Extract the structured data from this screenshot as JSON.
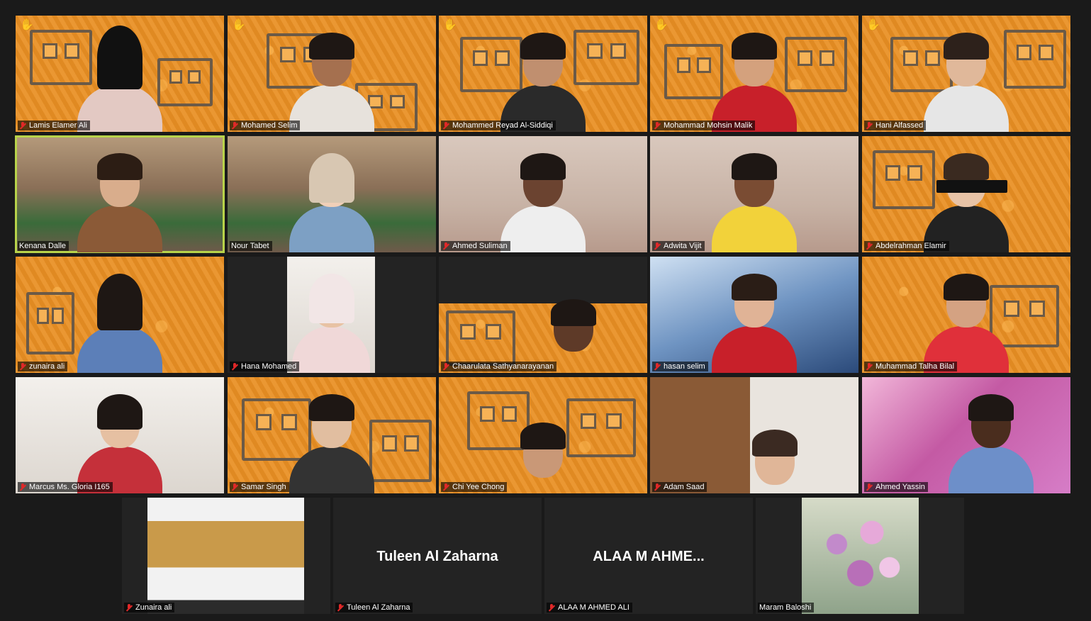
{
  "participants": [
    {
      "name": "Lamis Elamer Ali",
      "muted": true,
      "hand": true
    },
    {
      "name": "Mohamed Selim",
      "muted": true,
      "hand": true
    },
    {
      "name": "Mohammed Reyad Al-Siddiqi",
      "muted": true,
      "hand": true
    },
    {
      "name": "Mohammad Mohsin Malik",
      "muted": true,
      "hand": true
    },
    {
      "name": "Hani Alfassed",
      "muted": true,
      "hand": true
    },
    {
      "name": "Kenana Dalle",
      "muted": false,
      "hand": false,
      "active_speaker": true
    },
    {
      "name": "Nour Tabet",
      "muted": false,
      "hand": false
    },
    {
      "name": "Ahmed Suliman",
      "muted": true,
      "hand": false
    },
    {
      "name": "Adwita Vijit",
      "muted": true,
      "hand": false
    },
    {
      "name": "Abdelrahman Elamir",
      "muted": true,
      "hand": false
    },
    {
      "name": "zunaira ali",
      "muted": true,
      "hand": false
    },
    {
      "name": "Hana Mohamed",
      "muted": true,
      "hand": false
    },
    {
      "name": "Chaarulata Sathyanarayanan",
      "muted": true,
      "hand": false
    },
    {
      "name": "hasan selim",
      "muted": true,
      "hand": false
    },
    {
      "name": "Muhammad Talha Bilal",
      "muted": true,
      "hand": false
    },
    {
      "name": "Marcus Ms. Gloria I165",
      "muted": true,
      "hand": false
    },
    {
      "name": "Samar Singh",
      "muted": true,
      "hand": false
    },
    {
      "name": "Chi Yee Chong",
      "muted": true,
      "hand": false
    },
    {
      "name": "Adam Saad",
      "muted": true,
      "hand": false
    },
    {
      "name": "Ahmed Yassin",
      "muted": true,
      "hand": false
    },
    {
      "name": "Zunaira ali",
      "muted": true,
      "hand": false
    },
    {
      "name": "Tuleen Al Zaharna",
      "muted": true,
      "hand": false,
      "video_off_display": "Tuleen Al Zaharna"
    },
    {
      "name": "ALAA M AHMED ALI",
      "muted": true,
      "hand": false,
      "video_off_display": "ALAA  M  AHME..."
    },
    {
      "name": "Maram Baloshi",
      "muted": false,
      "hand": false
    }
  ],
  "colors": {
    "active_outline": "#b8d34a",
    "muted_icon": "#e02828",
    "raised_hand": "#ffcc33",
    "background": "#1a1a1a"
  },
  "icons": {
    "mic": "mic-muted-icon",
    "hand": "raised-hand-icon"
  }
}
